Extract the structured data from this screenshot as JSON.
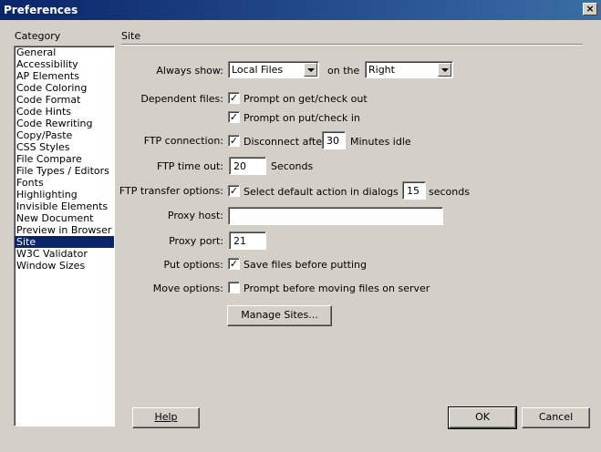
{
  "window": {
    "title": "Preferences",
    "close_glyph": "×"
  },
  "category": {
    "heading": "Category",
    "items": [
      "General",
      "Accessibility",
      "AP Elements",
      "Code Coloring",
      "Code Format",
      "Code Hints",
      "Code Rewriting",
      "Copy/Paste",
      "CSS Styles",
      "File Compare",
      "File Types / Editors",
      "Fonts",
      "Highlighting",
      "Invisible Elements",
      "New Document",
      "Preview in Browser",
      "Site",
      "W3C Validator",
      "Window Sizes"
    ],
    "selected": "Site"
  },
  "panel": {
    "title": "Site",
    "always_show": {
      "label": "Always show:",
      "value": "Local Files",
      "on_the": "on the",
      "side": "Right"
    },
    "dependent_files": {
      "label": "Dependent files:",
      "prompt_get": {
        "label": "Prompt on get/check out",
        "checked": true
      },
      "prompt_put": {
        "label": "Prompt on put/check in",
        "checked": true
      }
    },
    "ftp_connection": {
      "label": "FTP connection:",
      "disconnect": {
        "label": "Disconnect after",
        "checked": true
      },
      "minutes": "30",
      "minutes_suffix": "Minutes idle"
    },
    "ftp_timeout": {
      "label": "FTP time out:",
      "value": "20",
      "suffix": "Seconds"
    },
    "ftp_transfer": {
      "label": "FTP transfer options:",
      "select_default": {
        "label": "Select default action in dialogs after",
        "checked": true
      },
      "seconds": "15",
      "seconds_suffix": "seconds"
    },
    "proxy_host": {
      "label": "Proxy host:",
      "value": ""
    },
    "proxy_port": {
      "label": "Proxy port:",
      "value": "21"
    },
    "put_options": {
      "label": "Put options:",
      "save": {
        "label": "Save files before putting",
        "checked": true
      }
    },
    "move_options": {
      "label": "Move options:",
      "prompt": {
        "label": "Prompt before moving files on server",
        "checked": false
      }
    },
    "manage_sites": "Manage Sites..."
  },
  "buttons": {
    "help": "Help",
    "ok": "OK",
    "cancel": "Cancel"
  },
  "check_glyph": "✓"
}
